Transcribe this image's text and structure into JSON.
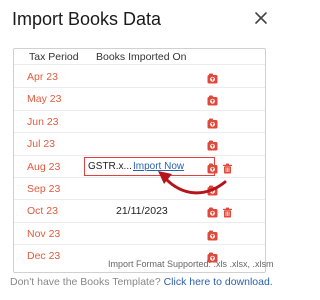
{
  "dialog": {
    "title": "Import Books Data",
    "icons": {
      "close": "close-icon",
      "upload": "upload-icon",
      "delete": "trash-icon"
    }
  },
  "table": {
    "headers": {
      "tax_period": "Tax Period",
      "books_imported_on": "Books Imported On"
    },
    "rows": [
      {
        "period": "Apr 23"
      },
      {
        "period": "May 23"
      },
      {
        "period": "Jun 23"
      },
      {
        "period": "Jul 23"
      },
      {
        "period": "Aug 23",
        "file_name": "GSTR.x...",
        "import_label": "Import Now",
        "deletable": true
      },
      {
        "period": "Sep 23"
      },
      {
        "period": "Oct 23",
        "imported_on": "21/11/2023",
        "deletable": true
      },
      {
        "period": "Nov 23"
      },
      {
        "period": "Dec 23"
      }
    ]
  },
  "footer": {
    "formats_note": "Import Format Supported: .xls .xlsx, .xlsm",
    "download_question": "Don't have the Books Template?",
    "download_link": "Click here to download."
  },
  "colors": {
    "period_text": "#e25a3c",
    "icon_accent": "#e0493a",
    "link": "#2a63b0",
    "highlight_border": "#e04040",
    "arrow": "#b5141c"
  }
}
